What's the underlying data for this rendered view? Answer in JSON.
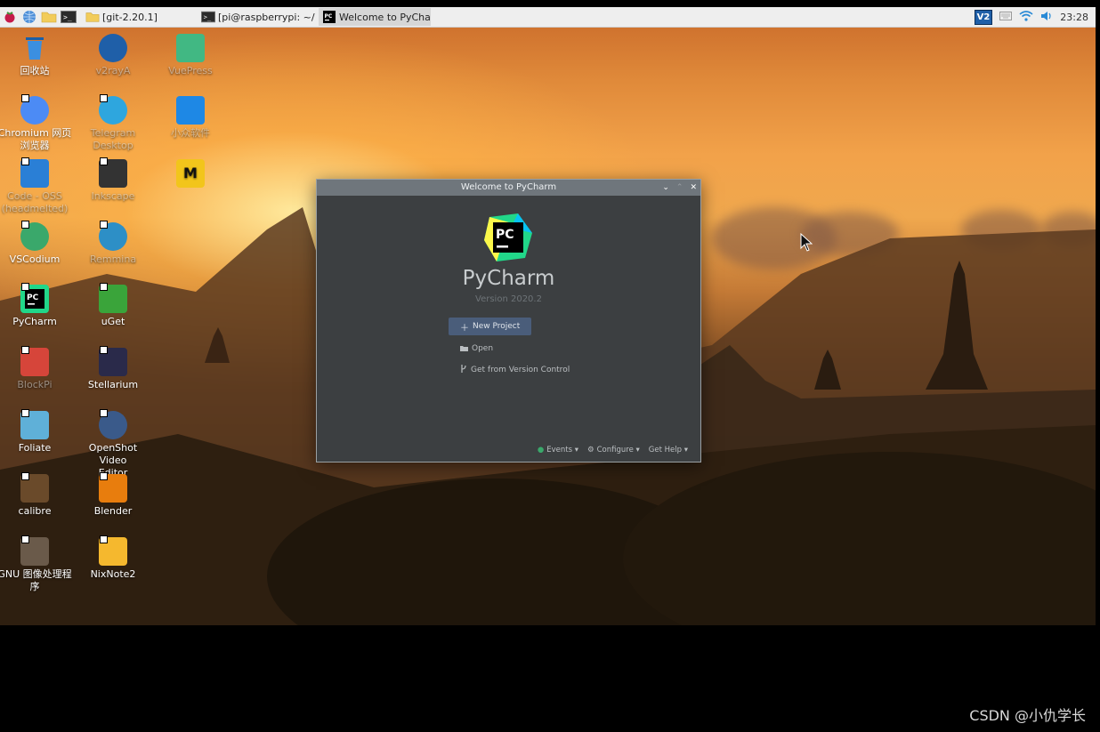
{
  "taskbar": {
    "tasks": [
      {
        "label": "[git-2.20.1]",
        "icon": "folder-icon"
      },
      {
        "label": "[pi@raspberrypi: ~/git...",
        "icon": "terminal-icon"
      },
      {
        "label": "Welcome to PyCharm",
        "icon": "pycharm-icon",
        "active": true
      }
    ],
    "tray": {
      "vpn_label": "V2",
      "clock": "23:28"
    }
  },
  "desktop": {
    "icons": [
      {
        "label": "回收站",
        "icon": "trash-icon",
        "color": "#2a7fd6"
      },
      {
        "label": "v2rayA",
        "icon": "v2raya-icon",
        "color": "#1f5fa8"
      },
      {
        "label": "VuePress",
        "icon": "vuepress-icon",
        "color": "#41b883"
      },
      {
        "label": "Chromium 网页\n浏览器",
        "icon": "chromium-icon",
        "color": "#4c8bf5"
      },
      {
        "label": "Telegram\nDesktop",
        "icon": "telegram-icon",
        "color": "#2ea6de"
      },
      {
        "label": "小众软件",
        "icon": "drop-icon",
        "color": "#1e88e5"
      },
      {
        "label": "Code - OSS\n(headmelted)",
        "icon": "code-oss-icon",
        "color": "#2a7fd6"
      },
      {
        "label": "Inkscape",
        "icon": "inkscape-icon",
        "color": "#333333"
      },
      {
        "label": "M",
        "icon": "m-app-icon",
        "color": "#f2c51b"
      },
      {
        "label": "VSCodium",
        "icon": "vscodium-icon",
        "color": "#3aa86b"
      },
      {
        "label": "Remmina",
        "icon": "remmina-icon",
        "color": "#2d8fc6"
      },
      {
        "label": "PyCharm",
        "icon": "pycharm-icon",
        "color": "#21d789"
      },
      {
        "label": "uGet",
        "icon": "uget-icon",
        "color": "#3aa43a"
      },
      {
        "label": "BlockPi",
        "icon": "blockpi-icon",
        "color": "#d6453a"
      },
      {
        "label": "Stellarium",
        "icon": "stellarium-icon",
        "color": "#2a2a4a"
      },
      {
        "label": "Foliate",
        "icon": "foliate-icon",
        "color": "#5fb0d8"
      },
      {
        "label": "OpenShot Video\nEditor",
        "icon": "openshot-icon",
        "color": "#3a5a8a"
      },
      {
        "label": "calibre",
        "icon": "calibre-icon",
        "color": "#6a4a2a"
      },
      {
        "label": "Blender",
        "icon": "blender-icon",
        "color": "#e87d0d"
      },
      {
        "label": "GNU 图像处理程\n序",
        "icon": "gimp-icon",
        "color": "#6a5a4a"
      },
      {
        "label": "NixNote2",
        "icon": "nixnote-icon",
        "color": "#f5b82e"
      }
    ]
  },
  "dialog": {
    "title": "Welcome to PyCharm",
    "app_name": "PyCharm",
    "version": "Version 2020.2",
    "logo_text": "PC",
    "actions": [
      {
        "label": "New Project",
        "icon": "plus-icon"
      },
      {
        "label": "Open",
        "icon": "folder-open-icon"
      },
      {
        "label": "Get from Version Control",
        "icon": "vcs-icon"
      }
    ],
    "footer": [
      {
        "label": "Events ▾",
        "icon": "events-icon"
      },
      {
        "label": "Configure ▾",
        "icon": "gear-icon"
      },
      {
        "label": "Get Help ▾",
        "icon": "help-icon"
      }
    ]
  },
  "watermark": "CSDN @小仇学长"
}
